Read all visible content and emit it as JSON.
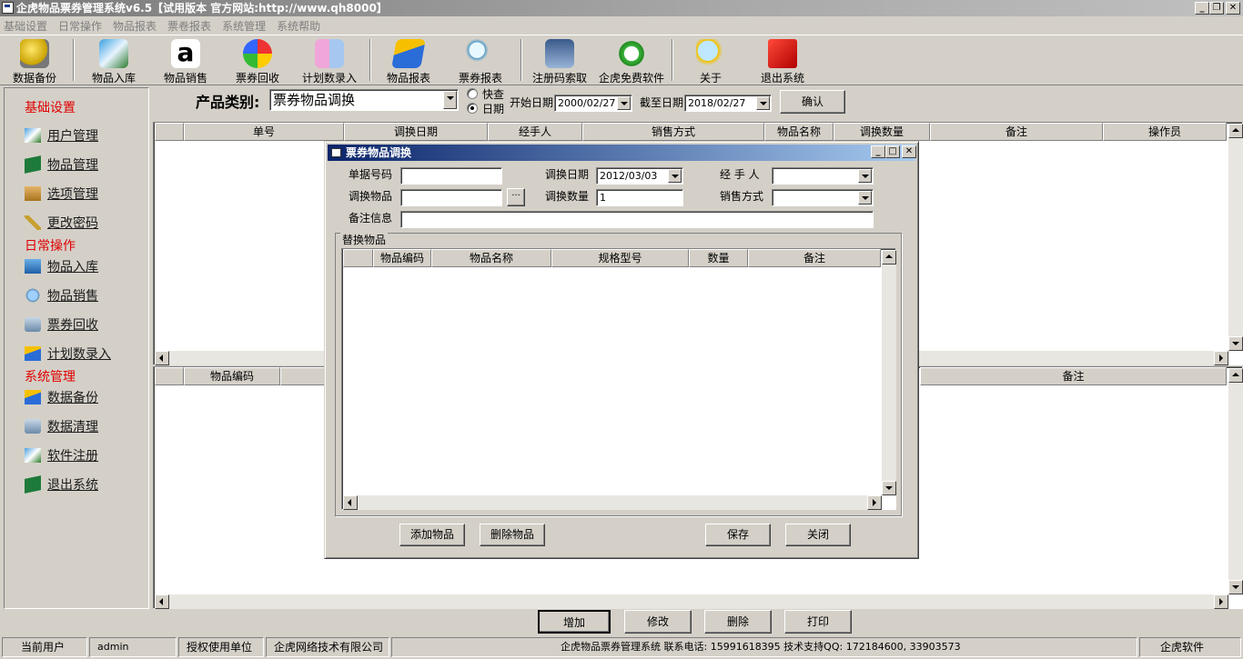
{
  "window": {
    "title": "企虎物品票券管理系统v6.5【试用版本 官方网站:http://www.qh8000】",
    "minimize_glyph": "_",
    "restore_glyph": "❐",
    "close_glyph": "✕"
  },
  "menu": [
    "基础设置",
    "日常操作",
    "物品报表",
    "票卷报表",
    "系统管理",
    "系统帮助"
  ],
  "toolbar": [
    {
      "label": "数据备份",
      "icon": "database-backup-icon"
    },
    {
      "label": "物品入库",
      "icon": "stock-in-icon"
    },
    {
      "label": "物品销售",
      "icon": "amazon-sales-icon"
    },
    {
      "label": "票券回收",
      "icon": "ticket-recycle-icon"
    },
    {
      "label": "计划数录入",
      "icon": "plan-entry-icon"
    },
    {
      "label": "物品报表",
      "icon": "item-report-icon"
    },
    {
      "label": "票券报表",
      "icon": "ticket-report-icon"
    },
    {
      "label": "注册码索取",
      "icon": "register-code-icon"
    },
    {
      "label": "企虎免费软件",
      "icon": "free-software-icon"
    },
    {
      "label": "关于",
      "icon": "about-icon"
    },
    {
      "label": "退出系统",
      "icon": "exit-system-icon"
    }
  ],
  "sidebar": {
    "basic_title": "基础设置",
    "basic_items": [
      "用户管理",
      "物品管理",
      "选项管理",
      "更改密码"
    ],
    "daily_title": "日常操作",
    "daily_items": [
      "物品入库",
      "物品销售",
      "票券回收",
      "计划数录入"
    ],
    "system_title": "系统管理",
    "system_items": [
      "数据备份",
      "数据清理",
      "软件注册",
      "退出系统"
    ]
  },
  "filter": {
    "category_label": "产品类别:",
    "category_value": "票券物品调换",
    "radio_quick": "快查",
    "radio_date": "日期",
    "start_label": "开始日期",
    "start_value": "2000/02/27",
    "end_label": "截至日期",
    "end_value": "2018/02/27",
    "confirm": "确认"
  },
  "main_grid": {
    "columns": [
      "单号",
      "调换日期",
      "经手人",
      "销售方式",
      "物品名称",
      "调换数量",
      "备注",
      "操作员"
    ]
  },
  "detail_grid": {
    "columns": [
      "物品编码",
      "备注"
    ]
  },
  "dialog": {
    "title": "票券物品调换",
    "doc_no_label": "单据号码",
    "doc_no_value": "",
    "swap_date_label": "调换日期",
    "swap_date_value": "2012/03/03",
    "handler_label": "经 手 人",
    "handler_value": "",
    "swap_item_label": "调换物品",
    "swap_item_value": "",
    "browse": "···",
    "swap_qty_label": "调换数量",
    "swap_qty_value": "1",
    "sale_mode_label": "销售方式",
    "sale_mode_value": "",
    "remark_label": "备注信息",
    "remark_value": "",
    "group_title": "替换物品",
    "columns": [
      "物品编码",
      "物品名称",
      "规格型号",
      "数量",
      "备注"
    ],
    "add_item": "添加物品",
    "delete_item": "删除物品",
    "save": "保存",
    "close": "关闭"
  },
  "actions": [
    "增加",
    "修改",
    "删除",
    "打印"
  ],
  "status": {
    "user_label": "当前用户",
    "user_value": "admin",
    "licensee_label": "授权使用单位",
    "licensee_value": "企虎网络技术有限公司",
    "info": "企虎物品票券管理系统  联系电话: 15991618395  技术支持QQ: 172184600, 33903573",
    "brand": "企虎软件"
  },
  "colors": {
    "section_red": "#e00000",
    "dialog_title_start": "#0a246a",
    "dialog_title_end": "#a6caf0"
  }
}
